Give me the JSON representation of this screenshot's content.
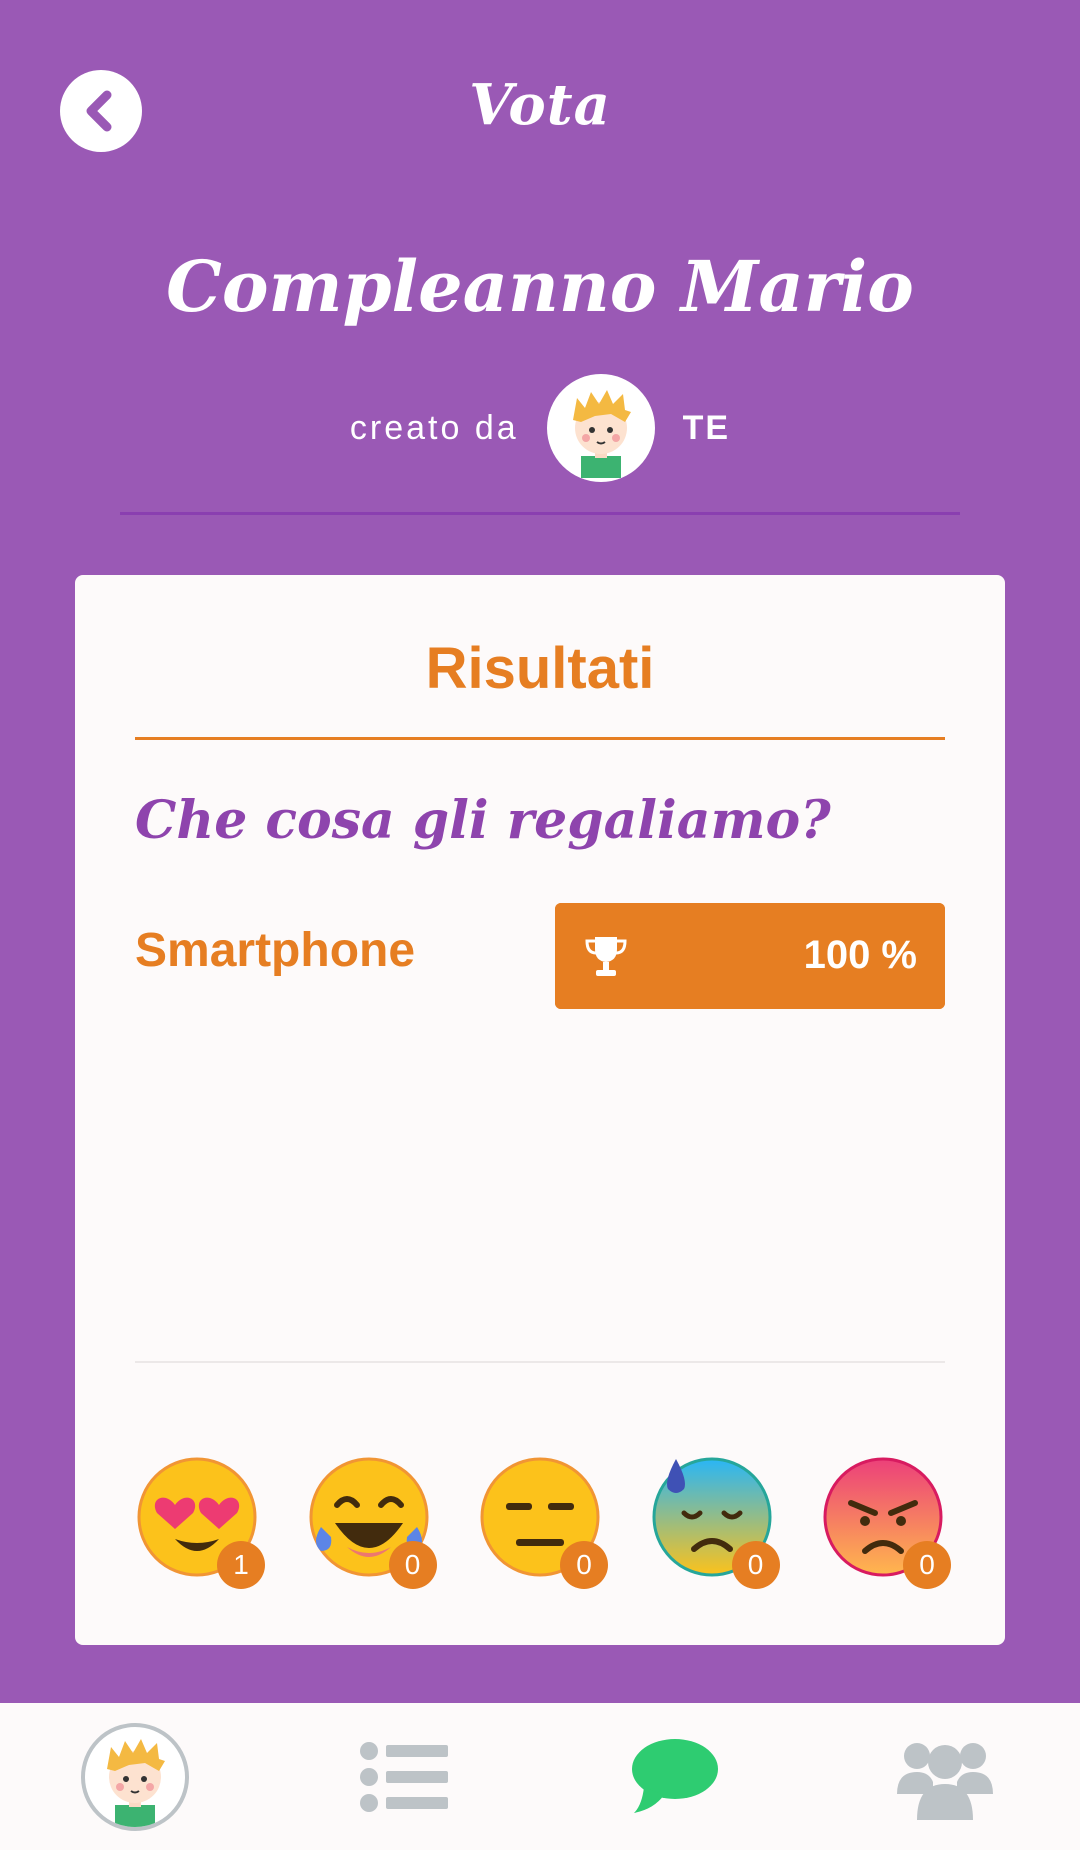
{
  "header": {
    "title": "Vota"
  },
  "event": {
    "title": "Compleanno Mario",
    "creator_label": "creato da",
    "creator_name": "TE"
  },
  "card": {
    "title": "Risultati",
    "question": "Che cosa gli regaliamo?",
    "options": [
      {
        "label": "Smartphone",
        "percent_text": "100 %",
        "percent": 100
      }
    ],
    "reactions": [
      {
        "icon": "heart-eyes-emoji-icon",
        "count": "1"
      },
      {
        "icon": "tears-of-joy-emoji-icon",
        "count": "0"
      },
      {
        "icon": "expressionless-emoji-icon",
        "count": "0"
      },
      {
        "icon": "cold-sweat-emoji-icon",
        "count": "0"
      },
      {
        "icon": "angry-emoji-icon",
        "count": "0"
      }
    ]
  },
  "nav": [
    {
      "icon": "profile-avatar-icon"
    },
    {
      "icon": "list-icon"
    },
    {
      "icon": "chat-icon",
      "active": true
    },
    {
      "icon": "group-icon"
    }
  ],
  "colors": {
    "background": "#9a59b5",
    "accent": "#e67e22",
    "question": "#8e44ad",
    "nav_active": "#2ecc71",
    "nav_inactive": "#bdc3c7"
  }
}
